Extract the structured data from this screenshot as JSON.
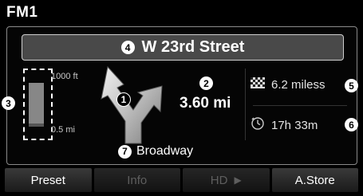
{
  "screen": {
    "title": "FM1"
  },
  "guidance": {
    "street": "W 23rd Street",
    "distance": "3.60 mi",
    "next_street": "Broadway",
    "scale": {
      "top_label": "1000 ft",
      "bottom_label": "0.5 mi",
      "progress": 0.8
    }
  },
  "trip": {
    "remaining_distance": "6.2 miless",
    "arrival_time": "17h 33m"
  },
  "callouts": [
    "1",
    "2",
    "3",
    "4",
    "5",
    "6",
    "7"
  ],
  "softkeys": [
    {
      "label": "Preset",
      "enabled": true
    },
    {
      "label": "Info",
      "enabled": false
    },
    {
      "label": "HD",
      "enabled": false
    },
    {
      "label": "A.Store",
      "enabled": true
    }
  ],
  "icons": {
    "turn": "turn-right-arrow-icon",
    "checkered_flag": "checkered-flag-icon",
    "clock": "clock-icon",
    "play": "play-triangle-icon"
  }
}
